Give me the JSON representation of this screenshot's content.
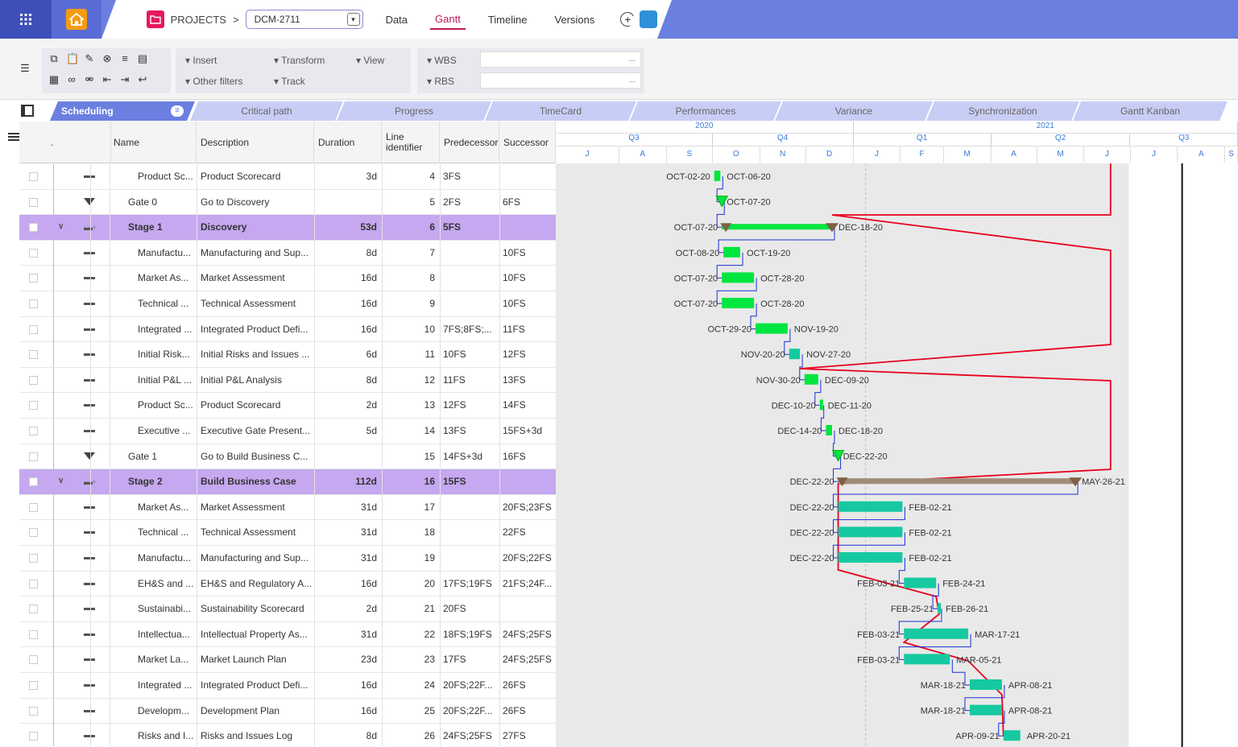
{
  "topbar": {
    "breadcrumb": "PROJECTS",
    "chevron": ">",
    "project_id": "DCM-2711",
    "tabs": [
      "Data",
      "Gantt",
      "Timeline",
      "Versions"
    ],
    "active_tab": "Gantt"
  },
  "toolbar": {
    "menus": [
      "Insert",
      "Transform",
      "View",
      "Other filters",
      "Track",
      "WBS",
      "RBS"
    ],
    "wbs_value": "...",
    "rbs_value": "..."
  },
  "views": [
    "Scheduling",
    "Critical path",
    "Progress",
    "TimeCard",
    "Performances",
    "Variance",
    "Synchronization",
    "Gantt Kanban"
  ],
  "grid": {
    "columns": [
      ".",
      "Name",
      "Description",
      "Duration",
      "Line identifier",
      "Predecessor",
      "Successor"
    ],
    "rows": [
      {
        "type": "task",
        "name": "Product Sc...",
        "description": "Product Scorecard",
        "duration": "3d",
        "line": "4",
        "pred": "3FS",
        "succ": ""
      },
      {
        "type": "gate",
        "name": "Gate 0",
        "description": "Go to Discovery",
        "duration": "",
        "line": "5",
        "pred": "2FS",
        "succ": "6FS"
      },
      {
        "type": "stage",
        "name": "Stage 1",
        "description": "Discovery",
        "duration": "53d",
        "line": "6",
        "pred": "5FS",
        "succ": ""
      },
      {
        "type": "task",
        "name": "Manufactu...",
        "description": "Manufacturing and Sup...",
        "duration": "8d",
        "line": "7",
        "pred": "",
        "succ": "10FS"
      },
      {
        "type": "task",
        "name": "Market As...",
        "description": "Market Assessment",
        "duration": "16d",
        "line": "8",
        "pred": "",
        "succ": "10FS"
      },
      {
        "type": "task",
        "name": "Technical ...",
        "description": "Technical Assessment",
        "duration": "16d",
        "line": "9",
        "pred": "",
        "succ": "10FS"
      },
      {
        "type": "task",
        "name": "Integrated ...",
        "description": "Integrated Product Defi...",
        "duration": "16d",
        "line": "10",
        "pred": "7FS;8FS;...",
        "succ": "11FS"
      },
      {
        "type": "task",
        "name": "Initial Risk...",
        "description": "Initial Risks and Issues ...",
        "duration": "6d",
        "line": "11",
        "pred": "10FS",
        "succ": "12FS"
      },
      {
        "type": "task",
        "name": "Initial P&L ...",
        "description": "Initial P&L Analysis",
        "duration": "8d",
        "line": "12",
        "pred": "11FS",
        "succ": "13FS"
      },
      {
        "type": "task",
        "name": "Product Sc...",
        "description": "Product Scorecard",
        "duration": "2d",
        "line": "13",
        "pred": "12FS",
        "succ": "14FS"
      },
      {
        "type": "task",
        "name": "Executive ...",
        "description": "Executive Gate Present...",
        "duration": "5d",
        "line": "14",
        "pred": "13FS",
        "succ": "15FS+3d"
      },
      {
        "type": "gate",
        "name": "Gate 1",
        "description": "Go to Build Business C...",
        "duration": "",
        "line": "15",
        "pred": "14FS+3d",
        "succ": "16FS"
      },
      {
        "type": "stage",
        "name": "Stage 2",
        "description": "Build Business Case",
        "duration": "112d",
        "line": "16",
        "pred": "15FS",
        "succ": ""
      },
      {
        "type": "task",
        "name": "Market As...",
        "description": "Market Assessment",
        "duration": "31d",
        "line": "17",
        "pred": "",
        "succ": "20FS;23FS"
      },
      {
        "type": "task",
        "name": "Technical ...",
        "description": "Technical Assessment",
        "duration": "31d",
        "line": "18",
        "pred": "",
        "succ": "22FS"
      },
      {
        "type": "task",
        "name": "Manufactu...",
        "description": "Manufacturing and Sup...",
        "duration": "31d",
        "line": "19",
        "pred": "",
        "succ": "20FS;22FS"
      },
      {
        "type": "task",
        "name": "EH&S and ...",
        "description": "EH&S and Regulatory A...",
        "duration": "16d",
        "line": "20",
        "pred": "17FS;19FS",
        "succ": "21FS;24F..."
      },
      {
        "type": "task",
        "name": "Sustainabi...",
        "description": "Sustainability Scorecard",
        "duration": "2d",
        "line": "21",
        "pred": "20FS",
        "succ": ""
      },
      {
        "type": "task",
        "name": "Intellectua...",
        "description": "Intellectual Property As...",
        "duration": "31d",
        "line": "22",
        "pred": "18FS;19FS",
        "succ": "24FS;25FS"
      },
      {
        "type": "task",
        "name": "Market La...",
        "description": "Market Launch Plan",
        "duration": "23d",
        "line": "23",
        "pred": "17FS",
        "succ": "24FS;25FS"
      },
      {
        "type": "task",
        "name": "Integrated ...",
        "description": "Integrated Product Defi...",
        "duration": "16d",
        "line": "24",
        "pred": "20FS;22F...",
        "succ": "26FS"
      },
      {
        "type": "task",
        "name": "Developm...",
        "description": "Development Plan",
        "duration": "16d",
        "line": "25",
        "pred": "20FS;22F...",
        "succ": "26FS"
      },
      {
        "type": "task",
        "name": "Risks and I...",
        "description": "Risks and Issues Log",
        "duration": "8d",
        "line": "26",
        "pred": "24FS;25FS",
        "succ": "27FS"
      }
    ]
  },
  "timeline": {
    "years": [
      "2020",
      "2021"
    ],
    "quarters": [
      "Q3",
      "Q4",
      "Q1",
      "Q2",
      "Q3"
    ],
    "months": [
      "J",
      "A",
      "S",
      "O",
      "N",
      "D",
      "J",
      "F",
      "M",
      "A",
      "M",
      "J",
      "J",
      "A",
      "S"
    ]
  },
  "gantt": {
    "bars": [
      {
        "row": 0,
        "kind": "task",
        "start": "OCT-02-20",
        "end": "OCT-06-20",
        "s": "2020-10-02",
        "e": "2020-10-06"
      },
      {
        "row": 1,
        "kind": "milestone",
        "start": "",
        "end": "OCT-07-20",
        "s": "2020-10-07",
        "e": "2020-10-07"
      },
      {
        "row": 2,
        "kind": "summary",
        "start": "OCT-07-20",
        "end": "DEC-18-20",
        "s": "2020-10-07",
        "e": "2020-12-18"
      },
      {
        "row": 3,
        "kind": "task",
        "start": "OCT-08-20",
        "end": "OCT-19-20",
        "s": "2020-10-08",
        "e": "2020-10-19"
      },
      {
        "row": 4,
        "kind": "task",
        "start": "OCT-07-20",
        "end": "OCT-28-20",
        "s": "2020-10-07",
        "e": "2020-10-28"
      },
      {
        "row": 5,
        "kind": "task",
        "start": "OCT-07-20",
        "end": "OCT-28-20",
        "s": "2020-10-07",
        "e": "2020-10-28"
      },
      {
        "row": 6,
        "kind": "task",
        "start": "OCT-29-20",
        "end": "NOV-19-20",
        "s": "2020-10-29",
        "e": "2020-11-19"
      },
      {
        "row": 7,
        "kind": "task2",
        "start": "NOV-20-20",
        "end": "NOV-27-20",
        "s": "2020-11-20",
        "e": "2020-11-27"
      },
      {
        "row": 8,
        "kind": "task",
        "start": "NOV-30-20",
        "end": "DEC-09-20",
        "s": "2020-11-30",
        "e": "2020-12-09"
      },
      {
        "row": 9,
        "kind": "task",
        "start": "DEC-10-20",
        "end": "DEC-11-20",
        "s": "2020-12-10",
        "e": "2020-12-11"
      },
      {
        "row": 10,
        "kind": "task",
        "start": "DEC-14-20",
        "end": "DEC-18-20",
        "s": "2020-12-14",
        "e": "2020-12-18"
      },
      {
        "row": 11,
        "kind": "milestone",
        "start": "",
        "end": "DEC-22-20",
        "s": "2020-12-22",
        "e": "2020-12-22"
      },
      {
        "row": 12,
        "kind": "summary2",
        "start": "DEC-22-20",
        "end": "MAY-26-21",
        "s": "2020-12-22",
        "e": "2021-05-26"
      },
      {
        "row": 13,
        "kind": "task2",
        "start": "DEC-22-20",
        "end": "FEB-02-21",
        "s": "2020-12-22",
        "e": "2021-02-02"
      },
      {
        "row": 14,
        "kind": "task2",
        "start": "DEC-22-20",
        "end": "FEB-02-21",
        "s": "2020-12-22",
        "e": "2021-02-02"
      },
      {
        "row": 15,
        "kind": "task2",
        "start": "DEC-22-20",
        "end": "FEB-02-21",
        "s": "2020-12-22",
        "e": "2021-02-02"
      },
      {
        "row": 16,
        "kind": "task2",
        "start": "FEB-03-21",
        "end": "FEB-24-21",
        "s": "2021-02-03",
        "e": "2021-02-24"
      },
      {
        "row": 17,
        "kind": "task2",
        "start": "FEB-25-21",
        "end": "FEB-26-21",
        "s": "2021-02-25",
        "e": "2021-02-26"
      },
      {
        "row": 18,
        "kind": "task2",
        "start": "FEB-03-21",
        "end": "MAR-17-21",
        "s": "2021-02-03",
        "e": "2021-03-17"
      },
      {
        "row": 19,
        "kind": "task2",
        "start": "FEB-03-21",
        "end": "MAR-05-21",
        "s": "2021-02-03",
        "e": "2021-03-05"
      },
      {
        "row": 20,
        "kind": "task2",
        "start": "MAR-18-21",
        "end": "APR-08-21",
        "s": "2021-03-18",
        "e": "2021-04-08"
      },
      {
        "row": 21,
        "kind": "task2",
        "start": "MAR-18-21",
        "end": "APR-08-21",
        "s": "2021-03-18",
        "e": "2021-04-08"
      },
      {
        "row": 22,
        "kind": "task2",
        "start": "APR-09-21",
        "end": "APR-20-21",
        "s": "2021-04-09",
        "e": "2021-04-20"
      }
    ]
  },
  "colors": {
    "accent": "#6b7fe0",
    "stage_row": "#c5a8f0",
    "bar_green": "#00e640",
    "bar_teal": "#16c9a0",
    "summary": "#7d6146",
    "critical": "#e8001c",
    "link": "#1a2fd8"
  }
}
